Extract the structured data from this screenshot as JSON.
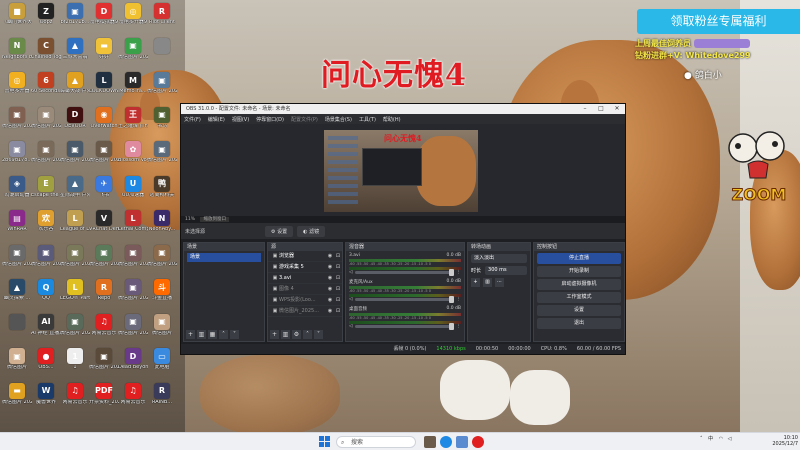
{
  "desktop_icons": [
    {
      "label": "《幽门世界大战 特...",
      "icon": "game-icon",
      "color": "#c89f3a",
      "glyph": "■"
    },
    {
      "label": "Oopz",
      "icon": "oopz-icon",
      "color": "#222",
      "glyph": "Z"
    },
    {
      "label": "bf2d171b...",
      "icon": "image-icon",
      "color": "#3b6fb0",
      "glyph": "▣"
    },
    {
      "label": "雷电模拟器9",
      "icon": "ld-icon",
      "color": "#e03030",
      "glyph": "D"
    },
    {
      "label": "雷电多开器9",
      "icon": "ldmulti-icon",
      "color": "#f0c030",
      "glyph": "◎"
    },
    {
      "label": "Riot Client",
      "icon": "riot-icon",
      "color": "#d63131",
      "glyph": "R"
    },
    {
      "label": "Neighbors back Fro...",
      "icon": "neighbors-icon",
      "color": "#6a8a4a",
      "glyph": "N"
    },
    {
      "label": "Chained Together",
      "icon": "chained-icon",
      "color": "#7a5030",
      "glyph": "C"
    },
    {
      "label": "三城大富翁",
      "icon": "game2-icon",
      "color": "#3070c0",
      "glyph": "▲"
    },
    {
      "label": "好好",
      "icon": "folder-icon",
      "color": "#f0c23a",
      "glyph": "▬"
    },
    {
      "label": "微信图片 2025-08-...",
      "icon": "image2-icon",
      "color": "#3aa04a",
      "glyph": "▣"
    },
    {
      "label": "",
      "icon": "blank-icon",
      "color": "#888",
      "glyph": ""
    },
    {
      "label": "雷电多开器",
      "icon": "ldmulti2-icon",
      "color": "#f0b020",
      "glyph": "◎"
    },
    {
      "label": "60 Seconds! Reatomized",
      "icon": "sixty-icon",
      "color": "#c04020",
      "glyph": "6"
    },
    {
      "label": "蟑螂大战 户外突围战...",
      "icon": "roach-icon",
      "color": "#e0a020",
      "glyph": "▲"
    },
    {
      "label": "LOCKDOWN Protocol",
      "icon": "lockdown-icon",
      "color": "#203040",
      "glyph": "L"
    },
    {
      "label": "MemoTra...",
      "icon": "memo-icon",
      "color": "#2a2a2a",
      "glyph": "M"
    },
    {
      "label": "微信图片 2025091...",
      "icon": "image3-icon",
      "color": "#5a7a9a",
      "glyph": "▣"
    },
    {
      "label": "微信图片 2025091...",
      "icon": "image4-icon",
      "color": "#806050",
      "glyph": "▣"
    },
    {
      "label": "微信图片 2025091...",
      "icon": "image5-icon",
      "color": "#9a8a7a",
      "glyph": "▣"
    },
    {
      "label": "DEVOUR",
      "icon": "devour-icon",
      "color": "#401010",
      "glyph": "D"
    },
    {
      "label": "Overwatch",
      "icon": "overwatch-icon",
      "color": "#e07020",
      "glyph": "◉"
    },
    {
      "label": "王之璀璨 (The King...",
      "icon": "king-icon",
      "color": "#c03030",
      "glyph": "王"
    },
    {
      "label": "书马",
      "icon": "shuma-icon",
      "color": "#506030",
      "glyph": "▣"
    },
    {
      "label": "2b69d178...",
      "icon": "image6-icon",
      "color": "#8a8aa0",
      "glyph": "▣"
    },
    {
      "label": "微信图片 2025091...",
      "icon": "image7-icon",
      "color": "#7a6a5a",
      "glyph": "▣"
    },
    {
      "label": "微信图片 2025073...",
      "icon": "image8-icon",
      "color": "#4a5a6a",
      "glyph": "▣"
    },
    {
      "label": "微信图片 2025091...",
      "icon": "image9-icon",
      "color": "#6a5a4a",
      "glyph": "▣"
    },
    {
      "label": "Blossom Voyage",
      "icon": "blossom-icon",
      "color": "#e08aa0",
      "glyph": "✿"
    },
    {
      "label": "微信图片 2025091...",
      "icon": "image10-icon",
      "color": "#5a6a7a",
      "glyph": "▣"
    },
    {
      "label": "鸣潮启动器",
      "icon": "wuwa-icon",
      "color": "#3a5a8a",
      "glyph": "◈"
    },
    {
      "label": "Escape the Backrooms",
      "icon": "backrooms-icon",
      "color": "#a0a040",
      "glyph": "E"
    },
    {
      "label": "星际战甲 户外突围战...",
      "icon": "warframe-icon",
      "color": "#4a6a8a",
      "glyph": "▲"
    },
    {
      "label": "飞书",
      "icon": "feishu-icon",
      "color": "#3a7ae0",
      "glyph": "✈"
    },
    {
      "label": "UU加速器",
      "icon": "uu-icon",
      "color": "#1e88e5",
      "glyph": "U"
    },
    {
      "label": "逃离鸭科夫",
      "icon": "duckov-icon",
      "color": "#4a3a2a",
      "glyph": "鸭"
    },
    {
      "label": "WinRAR",
      "icon": "winrar-icon",
      "color": "#8a2a8a",
      "glyph": "▤"
    },
    {
      "label": "欢乐谷",
      "icon": "joy-icon",
      "color": "#e0a030",
      "glyph": "欢"
    },
    {
      "label": "League of Legends",
      "icon": "lol-icon",
      "color": "#c0a050",
      "glyph": "L"
    },
    {
      "label": "VRChat Demo",
      "icon": "vrchat-icon",
      "color": "#2a2a2a",
      "glyph": "V"
    },
    {
      "label": "Lethal Company",
      "icon": "lethal-icon",
      "color": "#c03030",
      "glyph": "L"
    },
    {
      "label": "NeonAby...",
      "icon": "neon-icon",
      "color": "#3a2a6a",
      "glyph": "N"
    },
    {
      "label": "微信图片 2025091...",
      "icon": "image11-icon",
      "color": "#6a6a6a",
      "glyph": "▣"
    },
    {
      "label": "微信图片 2025091...",
      "icon": "image12-icon",
      "color": "#5a5a7a",
      "glyph": "▣"
    },
    {
      "label": "微信图片 2025091...",
      "icon": "image13-icon",
      "color": "#7a7a5a",
      "glyph": "▣"
    },
    {
      "label": "微信图片 2025091...",
      "icon": "image14-icon",
      "color": "#5a7a5a",
      "glyph": "▣"
    },
    {
      "label": "微信图片 2025091...",
      "icon": "image15-icon",
      "color": "#7a5a5a",
      "glyph": "▣"
    },
    {
      "label": "微信图片 2025-07...",
      "icon": "image16-icon",
      "color": "#8a6a4a",
      "glyph": "▣"
    },
    {
      "label": "幽灵探索 ...",
      "icon": "ghost-icon",
      "color": "#2a4a6a",
      "glyph": "▲"
    },
    {
      "label": "QQ",
      "icon": "qq-icon",
      "color": "#1a8ae0",
      "glyph": "Q"
    },
    {
      "label": "LEGO® Party",
      "icon": "lego-icon",
      "color": "#e0c020",
      "glyph": "L"
    },
    {
      "label": "Repo",
      "icon": "repo-icon",
      "color": "#e07020",
      "glyph": "R"
    },
    {
      "label": "微信图片 2025091...",
      "icon": "image17-icon",
      "color": "#6a5a7a",
      "glyph": "▣"
    },
    {
      "label": "斗鱼直播",
      "icon": "douyu-icon",
      "color": "#ff6a00",
      "glyph": "斗"
    },
    {
      "label": "",
      "icon": "blank2-icon",
      "color": "#555",
      "glyph": ""
    },
    {
      "label": "AI 神经 直播之谜",
      "icon": "ai-icon",
      "color": "#3a3a3a",
      "glyph": "AI"
    },
    {
      "label": "微信图片 2025091...",
      "icon": "image18-icon",
      "color": "#5a6a5a",
      "glyph": "▣"
    },
    {
      "label": "网易云音乐",
      "icon": "netease-icon",
      "color": "#e02020",
      "glyph": "♫"
    },
    {
      "label": "微信图片 2025091...",
      "icon": "image19-icon",
      "color": "#6a6a7a",
      "glyph": "▣"
    },
    {
      "label": "微信图片",
      "icon": "image20-icon",
      "color": "#c0a080",
      "glyph": "▣"
    },
    {
      "label": "微信图片",
      "icon": "image21-icon",
      "color": "#d0b090",
      "glyph": "▣"
    },
    {
      "label": "OBS...",
      "icon": "obs-icon",
      "color": "#e02020",
      "glyph": "●"
    },
    {
      "label": "1",
      "icon": "doc-icon",
      "color": "#eee",
      "glyph": "1"
    },
    {
      "label": "微信图片 2025091...",
      "icon": "image22-icon",
      "color": "#5a4a3a",
      "glyph": "▣"
    },
    {
      "label": "Dead Beyon...",
      "icon": "dead-icon",
      "color": "#6a3a8a",
      "glyph": "D"
    },
    {
      "label": "此电脑",
      "icon": "pc-icon",
      "color": "#3a8ae0",
      "glyph": "▭"
    },
    {
      "label": "微信图片 2025091...",
      "icon": "image23-icon",
      "color": "#e0a020",
      "glyph": "▬"
    },
    {
      "label": "魔兽世界",
      "icon": "wow-icon",
      "color": "#1a3a6a",
      "glyph": "W"
    },
    {
      "label": "网易云音乐",
      "icon": "netease2-icon",
      "color": "#e02020",
      "glyph": "♫"
    },
    {
      "label": "开票资料_2025...",
      "icon": "pdf-icon",
      "color": "#e02020",
      "glyph": "PDF"
    },
    {
      "label": "网易云音乐",
      "icon": "netease3-icon",
      "color": "#e02020",
      "glyph": "♫"
    },
    {
      "label": "RAINB...",
      "icon": "rainbow-icon",
      "color": "#3a3a5a",
      "glyph": "R"
    }
  ],
  "overlay": {
    "title": "问心无愧4",
    "fan_button": "领取粉丝专属福利",
    "promo_line1": "上周最佳饲养员",
    "promo_line2": "钻粉进群+V: Whitedove299",
    "streamer": "鸽白小",
    "logo_text": "ZOOM"
  },
  "obs": {
    "title": "OBS 31.0.0 - 配置文件: 未命名 - 场景: 未命名",
    "menu": [
      "文件(F)",
      "编辑(E)",
      "视图(V)",
      "停靠窗口(D)",
      "配置文件(P)",
      "场景集合(S)",
      "工具(T)",
      "帮助(H)"
    ],
    "preview_title": "问心无愧4",
    "zoom_label": "11%",
    "zoom_hint": "缩放到窗口",
    "current_scene": "未选择源",
    "btn_properties": "设置",
    "btn_filters": "滤镜",
    "docks": {
      "scenes": "场景",
      "sources": "源",
      "mixer": "混音器",
      "transitions": "转场动画",
      "controls": "控制按钮"
    },
    "scenes": [
      "场景"
    ],
    "sources": [
      {
        "name": "浏览器",
        "dim": false
      },
      {
        "name": "游戏采集 5",
        "dim": false
      },
      {
        "name": "3.avi",
        "dim": false
      },
      {
        "name": "图像 4",
        "dim": true
      },
      {
        "name": "WPS投影(Loo...",
        "dim": true
      },
      {
        "name": "微信图片_2025...",
        "dim": true
      }
    ],
    "mixer": [
      {
        "name": "3.avi",
        "db": "0.0 dB"
      },
      {
        "name": "麦克风/Aux",
        "db": "0.0 dB"
      },
      {
        "name": "桌面音频",
        "db": "0.0 dB"
      }
    ],
    "meter_ticks": "-60 -55 -50 -45 -40 -35 -30 -25 -20 -15 -10 -5 0",
    "transition": "淡入淡出",
    "duration_label": "时长",
    "duration": "300 ms",
    "controls": [
      "停止直播",
      "开始录制",
      "启动虚拟摄像机",
      "工作室模式",
      "设置",
      "退出"
    ],
    "status": {
      "dropped": "丢帧 0 (0.0%)",
      "bitrate": "14310 kbps",
      "live_time": "00:00:50",
      "rec_time": "00:00:00",
      "cpu": "CPU: 0.8%",
      "fps": "60.00 / 60.00 FPS"
    }
  },
  "taskbar": {
    "search_placeholder": "搜索",
    "lang": "中",
    "time": "10:10",
    "date": "2025/12/7"
  }
}
